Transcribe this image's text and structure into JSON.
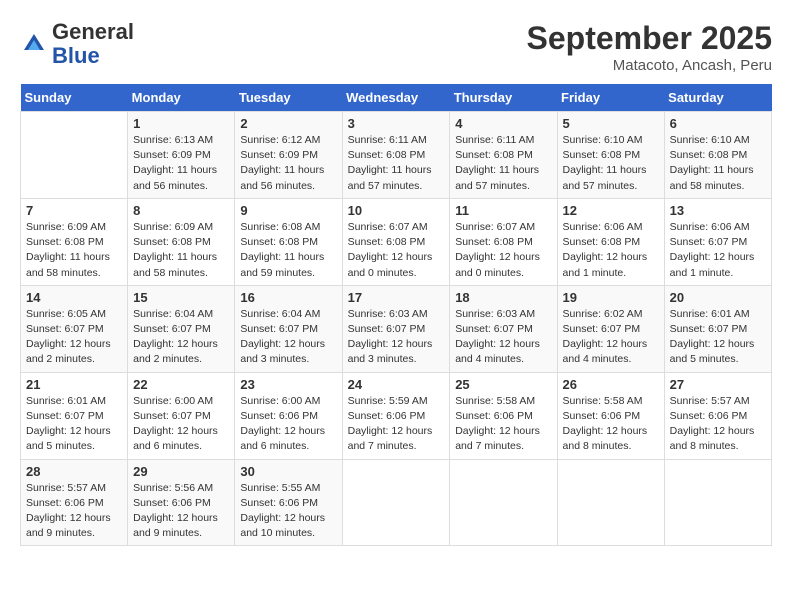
{
  "header": {
    "logo_general": "General",
    "logo_blue": "Blue",
    "month": "September 2025",
    "location": "Matacoto, Ancash, Peru"
  },
  "days_of_week": [
    "Sunday",
    "Monday",
    "Tuesday",
    "Wednesday",
    "Thursday",
    "Friday",
    "Saturday"
  ],
  "weeks": [
    [
      {
        "num": "",
        "info": ""
      },
      {
        "num": "1",
        "info": "Sunrise: 6:13 AM\nSunset: 6:09 PM\nDaylight: 11 hours\nand 56 minutes."
      },
      {
        "num": "2",
        "info": "Sunrise: 6:12 AM\nSunset: 6:09 PM\nDaylight: 11 hours\nand 56 minutes."
      },
      {
        "num": "3",
        "info": "Sunrise: 6:11 AM\nSunset: 6:08 PM\nDaylight: 11 hours\nand 57 minutes."
      },
      {
        "num": "4",
        "info": "Sunrise: 6:11 AM\nSunset: 6:08 PM\nDaylight: 11 hours\nand 57 minutes."
      },
      {
        "num": "5",
        "info": "Sunrise: 6:10 AM\nSunset: 6:08 PM\nDaylight: 11 hours\nand 57 minutes."
      },
      {
        "num": "6",
        "info": "Sunrise: 6:10 AM\nSunset: 6:08 PM\nDaylight: 11 hours\nand 58 minutes."
      }
    ],
    [
      {
        "num": "7",
        "info": "Sunrise: 6:09 AM\nSunset: 6:08 PM\nDaylight: 11 hours\nand 58 minutes."
      },
      {
        "num": "8",
        "info": "Sunrise: 6:09 AM\nSunset: 6:08 PM\nDaylight: 11 hours\nand 58 minutes."
      },
      {
        "num": "9",
        "info": "Sunrise: 6:08 AM\nSunset: 6:08 PM\nDaylight: 11 hours\nand 59 minutes."
      },
      {
        "num": "10",
        "info": "Sunrise: 6:07 AM\nSunset: 6:08 PM\nDaylight: 12 hours\nand 0 minutes."
      },
      {
        "num": "11",
        "info": "Sunrise: 6:07 AM\nSunset: 6:08 PM\nDaylight: 12 hours\nand 0 minutes."
      },
      {
        "num": "12",
        "info": "Sunrise: 6:06 AM\nSunset: 6:08 PM\nDaylight: 12 hours\nand 1 minute."
      },
      {
        "num": "13",
        "info": "Sunrise: 6:06 AM\nSunset: 6:07 PM\nDaylight: 12 hours\nand 1 minute."
      }
    ],
    [
      {
        "num": "14",
        "info": "Sunrise: 6:05 AM\nSunset: 6:07 PM\nDaylight: 12 hours\nand 2 minutes."
      },
      {
        "num": "15",
        "info": "Sunrise: 6:04 AM\nSunset: 6:07 PM\nDaylight: 12 hours\nand 2 minutes."
      },
      {
        "num": "16",
        "info": "Sunrise: 6:04 AM\nSunset: 6:07 PM\nDaylight: 12 hours\nand 3 minutes."
      },
      {
        "num": "17",
        "info": "Sunrise: 6:03 AM\nSunset: 6:07 PM\nDaylight: 12 hours\nand 3 minutes."
      },
      {
        "num": "18",
        "info": "Sunrise: 6:03 AM\nSunset: 6:07 PM\nDaylight: 12 hours\nand 4 minutes."
      },
      {
        "num": "19",
        "info": "Sunrise: 6:02 AM\nSunset: 6:07 PM\nDaylight: 12 hours\nand 4 minutes."
      },
      {
        "num": "20",
        "info": "Sunrise: 6:01 AM\nSunset: 6:07 PM\nDaylight: 12 hours\nand 5 minutes."
      }
    ],
    [
      {
        "num": "21",
        "info": "Sunrise: 6:01 AM\nSunset: 6:07 PM\nDaylight: 12 hours\nand 5 minutes."
      },
      {
        "num": "22",
        "info": "Sunrise: 6:00 AM\nSunset: 6:07 PM\nDaylight: 12 hours\nand 6 minutes."
      },
      {
        "num": "23",
        "info": "Sunrise: 6:00 AM\nSunset: 6:06 PM\nDaylight: 12 hours\nand 6 minutes."
      },
      {
        "num": "24",
        "info": "Sunrise: 5:59 AM\nSunset: 6:06 PM\nDaylight: 12 hours\nand 7 minutes."
      },
      {
        "num": "25",
        "info": "Sunrise: 5:58 AM\nSunset: 6:06 PM\nDaylight: 12 hours\nand 7 minutes."
      },
      {
        "num": "26",
        "info": "Sunrise: 5:58 AM\nSunset: 6:06 PM\nDaylight: 12 hours\nand 8 minutes."
      },
      {
        "num": "27",
        "info": "Sunrise: 5:57 AM\nSunset: 6:06 PM\nDaylight: 12 hours\nand 8 minutes."
      }
    ],
    [
      {
        "num": "28",
        "info": "Sunrise: 5:57 AM\nSunset: 6:06 PM\nDaylight: 12 hours\nand 9 minutes."
      },
      {
        "num": "29",
        "info": "Sunrise: 5:56 AM\nSunset: 6:06 PM\nDaylight: 12 hours\nand 9 minutes."
      },
      {
        "num": "30",
        "info": "Sunrise: 5:55 AM\nSunset: 6:06 PM\nDaylight: 12 hours\nand 10 minutes."
      },
      {
        "num": "",
        "info": ""
      },
      {
        "num": "",
        "info": ""
      },
      {
        "num": "",
        "info": ""
      },
      {
        "num": "",
        "info": ""
      }
    ]
  ]
}
